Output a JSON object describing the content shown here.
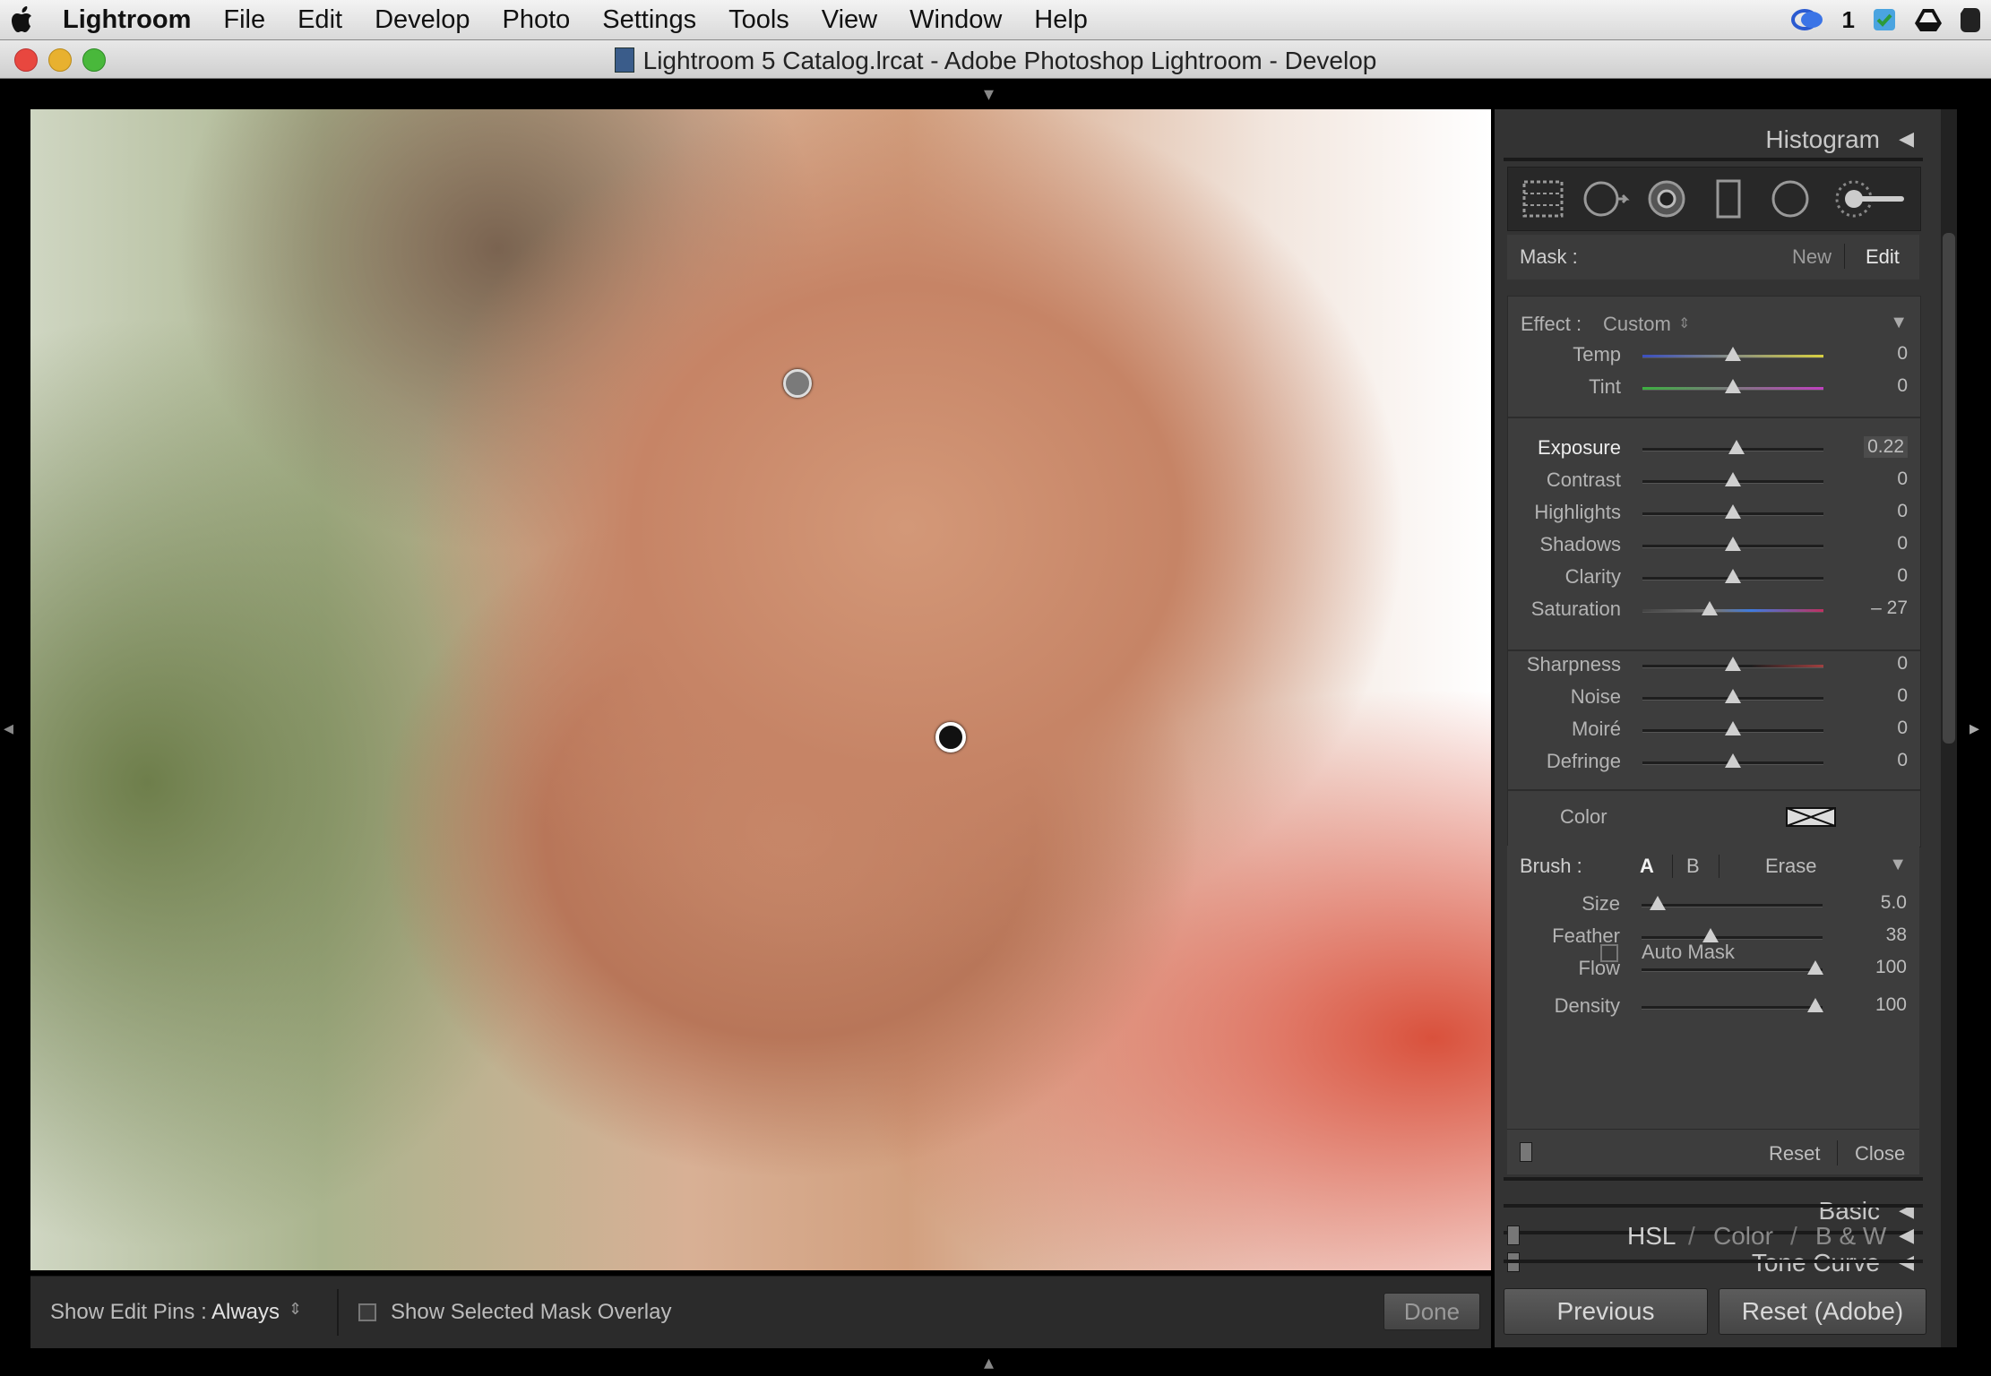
{
  "menubar": {
    "app": "Lightroom",
    "items": [
      "File",
      "Edit",
      "Develop",
      "Photo",
      "Settings",
      "Tools",
      "View",
      "Window",
      "Help"
    ],
    "badge": "1"
  },
  "window": {
    "title": "Lightroom 5 Catalog.lrcat - Adobe Photoshop Lightroom - Develop"
  },
  "panel": {
    "histogram_title": "Histogram",
    "mask": {
      "label": "Mask :",
      "new": "New",
      "edit": "Edit"
    },
    "effect": {
      "label": "Effect :",
      "preset": "Custom",
      "sliders": [
        {
          "name": "Temp",
          "value": "0",
          "pos": 0.5
        },
        {
          "name": "Tint",
          "value": "0",
          "pos": 0.5
        },
        {
          "name": "Exposure",
          "value": "0.22",
          "pos": 0.52
        },
        {
          "name": "Contrast",
          "value": "0",
          "pos": 0.5
        },
        {
          "name": "Highlights",
          "value": "0",
          "pos": 0.5
        },
        {
          "name": "Shadows",
          "value": "0",
          "pos": 0.5
        },
        {
          "name": "Clarity",
          "value": "0",
          "pos": 0.5
        },
        {
          "name": "Saturation",
          "value": "– 27",
          "pos": 0.37
        },
        {
          "name": "Sharpness",
          "value": "0",
          "pos": 0.5
        },
        {
          "name": "Noise",
          "value": "0",
          "pos": 0.5
        },
        {
          "name": "Moiré",
          "value": "0",
          "pos": 0.5
        },
        {
          "name": "Defringe",
          "value": "0",
          "pos": 0.5
        }
      ],
      "color_label": "Color"
    },
    "brush": {
      "label": "Brush :",
      "a": "A",
      "b": "B",
      "erase": "Erase",
      "sliders": [
        {
          "name": "Size",
          "value": "5.0",
          "pos": 0.09
        },
        {
          "name": "Feather",
          "value": "38",
          "pos": 0.38
        },
        {
          "name": "Flow",
          "value": "100",
          "pos": 0.96
        }
      ],
      "auto_mask": "Auto Mask",
      "density": {
        "name": "Density",
        "value": "100",
        "pos": 0.96
      }
    },
    "footer": {
      "reset": "Reset",
      "close": "Close"
    },
    "sections": {
      "basic": "Basic",
      "tone_curve": "Tone Curve",
      "hsl": "HSL",
      "color": "Color",
      "bw": "B & W",
      "slash": "/"
    },
    "buttons": {
      "previous": "Previous",
      "reset_adobe": "Reset (Adobe)"
    }
  },
  "toolbar": {
    "show_pins_label": "Show Edit Pins :",
    "show_pins_value": "Always",
    "overlay_label": "Show Selected Mask Overlay",
    "done": "Done"
  },
  "colors": {
    "panel_bg": "#333333",
    "accent_text": "#e2e2e2"
  }
}
